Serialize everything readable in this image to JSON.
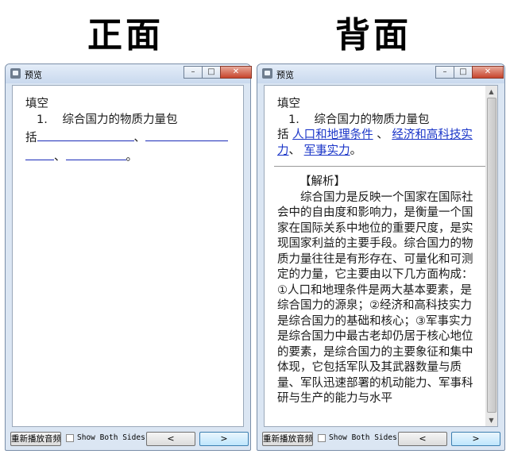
{
  "titles": {
    "front": "正面",
    "back": "背面"
  },
  "window": {
    "title": "预览",
    "controls": {
      "minimize": "–",
      "maximize": "□",
      "close": "✕"
    }
  },
  "question": {
    "type": "填空",
    "number": "1.",
    "stem_part1": "综合国力的物质力量包",
    "stem_part2": "括",
    "separator_1": "、",
    "separator_2": "、",
    "separator_3": "、",
    "period": "。",
    "answers": [
      "人口和地理条件",
      "经济和高科技实力",
      "军事实力"
    ]
  },
  "analysis": {
    "title": "【解析】",
    "body": "综合国力是反映一个国家在国际社会中的自由度和影响力，是衡量一个国家在国际关系中地位的重要尺度，是实现国家利益的主要手段。综合国力的物质力量往往是有形存在、可量化和可测定的力量，它主要由以下几方面构成：①人口和地理条件是两大基本要素，是综合国力的源泉；②经济和高科技实力是综合国力的基础和核心；③军事实力是综合国力中最古老却仍居于核心地位的要素，是综合国力的主要象征和集中体现，它包括军队及其武器数量与质量、军队迅速部署的机动能力、军事科研与生产的能力与水平"
  },
  "bottom": {
    "replay_label": "重新播放音频",
    "show_both_label": "Show Both Sides",
    "show_both_checked": false,
    "prev_label": "<",
    "next_label": ">"
  }
}
